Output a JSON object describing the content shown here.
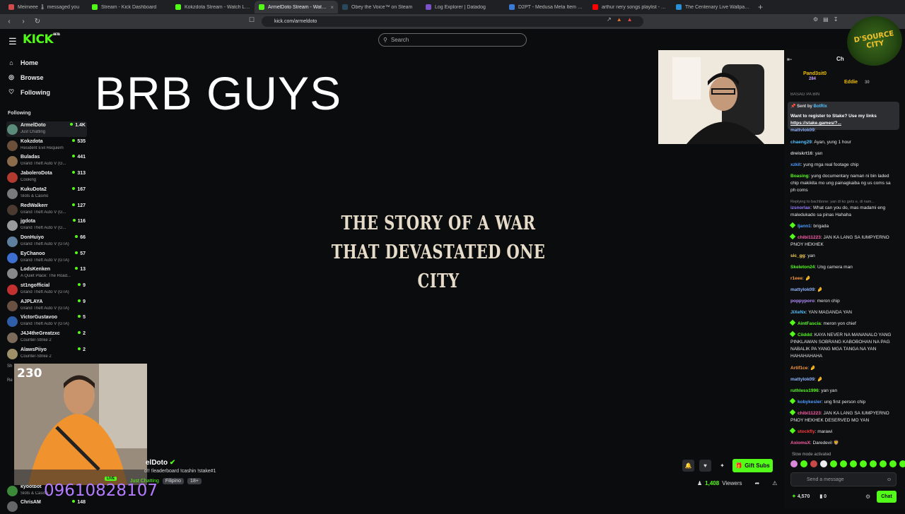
{
  "browser": {
    "tabs": [
      {
        "label": "Meimeee 🌡 messaged you",
        "color": "#d24b4b"
      },
      {
        "label": "Stream - Kick Dashboard",
        "color": "#53fc18"
      },
      {
        "label": "Kokzdota Stream - Watch Live on Ki",
        "color": "#53fc18"
      },
      {
        "label": "ArmelDoto Stream - Watch L",
        "color": "#53fc18",
        "active": true
      },
      {
        "label": "Obey the Voice™ on Steam",
        "color": "#2a475e"
      },
      {
        "label": "Log Explorer | Datadog",
        "color": "#7b52c9"
      },
      {
        "label": "D2PT - Medusa Meta Item Builds & ",
        "color": "#3a7bd5"
      },
      {
        "label": "arthur nery songs playlist - YouTube",
        "color": "#ff0000"
      },
      {
        "label": "The Centenary Live Wallpaper",
        "color": "#2b8fd6"
      }
    ],
    "new_tab": "+",
    "url": "kick.com/armeldoto"
  },
  "header": {
    "logo": "KICK",
    "logo_beta": "BETA",
    "search_placeholder": "Search"
  },
  "nav": {
    "home": "Home",
    "browse": "Browse",
    "following": "Following"
  },
  "following": {
    "heading": "Following",
    "channels": [
      {
        "name": "ArmelDoto",
        "game": "Just Chatting",
        "viewers": "1.4K",
        "color": "#5b8c7a"
      },
      {
        "name": "Kokzdota",
        "game": "Resident Evil Requiem",
        "viewers": "535",
        "color": "#6b4f3a"
      },
      {
        "name": "Buladas",
        "game": "Grand Theft Auto V (G...",
        "viewers": "441",
        "color": "#8a6c4a"
      },
      {
        "name": "JaboleroDota",
        "game": "Cooking",
        "viewers": "313",
        "color": "#b23a2e"
      },
      {
        "name": "KukuDota2",
        "game": "Slots & Casino",
        "viewers": "167",
        "color": "#7a7a7a"
      },
      {
        "name": "RedWalkerr",
        "game": "Grand Theft Auto V (G...",
        "viewers": "127",
        "color": "#4a3a30"
      },
      {
        "name": "jgdota",
        "game": "Grand Theft Auto V (G...",
        "viewers": "116",
        "color": "#9a9a9a"
      },
      {
        "name": "DonHuiyo",
        "game": "Grand Theft Auto V (GTA)",
        "viewers": "66",
        "color": "#5f7fa0"
      },
      {
        "name": "EyChanoo",
        "game": "Grand Theft Auto V (GTA)",
        "viewers": "57",
        "color": "#3c6fd0"
      },
      {
        "name": "LodsKenken",
        "game": "A Quiet Place: The Road...",
        "viewers": "13",
        "color": "#888888"
      },
      {
        "name": "st1ngofficial",
        "game": "Grand Theft Auto V (GTA)",
        "viewers": "9",
        "color": "#c23030"
      },
      {
        "name": "AJPLAYA",
        "game": "Grand Theft Auto V (GTA)",
        "viewers": "9",
        "color": "#6a5040"
      },
      {
        "name": "VictorGustavoo",
        "game": "Grand Theft Auto V (GTA)",
        "viewers": "5",
        "color": "#2e5ea8"
      },
      {
        "name": "J4J4theGreatzxc",
        "game": "Counter-Strike 2",
        "viewers": "2",
        "color": "#7c6a5a"
      },
      {
        "name": "AlawsPiiyo",
        "game": "Counter-Strike 2",
        "viewers": "2",
        "color": "#a0906a"
      }
    ],
    "partial": [
      {
        "name": "kyootbot",
        "game": "Slots & Casino",
        "viewers": "",
        "color": "#3a8a3a"
      },
      {
        "name": "ChrisAM",
        "game": "",
        "viewers": "148",
        "color": "#666666"
      }
    ],
    "clipped_text_1": "Sh",
    "clipped_text_2": "Re",
    "clipped_text_3": "Slots & Casino"
  },
  "stream": {
    "brb_text": "BRB GUYS",
    "story_line1": "THE STORY OF A WAR",
    "story_line2": "THAT DEVASTATED ONE CITY",
    "cam_count": "230",
    "phone": "09610828107",
    "live_badge": "LIVE",
    "streamer_name": "elDoto",
    "streamer_title": "o!! !leaderboard !cashin !stake#1",
    "category": "Just Chatting",
    "tags": [
      "Filipino",
      "18+"
    ],
    "viewers_count": "1,408",
    "viewers_label": "Viewers",
    "gift_subs": "Gift Subs"
  },
  "chat": {
    "header": "Ch",
    "leaderboard": [
      {
        "name": "Pand3sit0",
        "value": "284"
      },
      {
        "name": "Eddie",
        "value": "30"
      }
    ],
    "clipped_top_line": "BASAG PA BIN",
    "pinned": {
      "sender_prefix": "Sent by",
      "sender": "BotRix",
      "text": "Want to register to Stake? Use my links",
      "link": "https://stake.games/?..."
    },
    "messages": [
      {
        "user": "mattylok09",
        "text": "",
        "color": "#8fb4ff",
        "badge": false,
        "clipped": true
      },
      {
        "user": "chaeng29",
        "text": "Ayan, yung 1 hour",
        "color": "#53c1ff",
        "badge": false
      },
      {
        "user": "dreiskrt16",
        "text": "yan",
        "color": "#cccccc",
        "badge": false
      },
      {
        "user": "xzkit",
        "text": "yung mga real footage chip",
        "color": "#4d9dff",
        "badge": false
      },
      {
        "user": "Boasing",
        "text": "yung documentary naman ni bin laded chip makikita mo ung painagkaiba ng us coms sa ph coms",
        "color": "#53fc18",
        "badge": false
      },
      {
        "reply": "Replying to bachbone: yan di ko gets e, di nam..."
      },
      {
        "user": "izsnorlax",
        "text": "What can you do, mas madami eng maledukado sa pinas Hahaha",
        "color": "#9b7dff",
        "badge": false
      },
      {
        "user": "ljann1",
        "text": "brigada",
        "color": "#4d9dff",
        "badge": true
      },
      {
        "user": "chibi11223",
        "text": "JAN KA LANG SA IUMPYERNO PNOY HEKHEK",
        "color": "#ff5ea8",
        "badge": true
      },
      {
        "user": "sic_gg",
        "text": "yan",
        "color": "#ffd84d",
        "badge": false
      },
      {
        "user": "Skeleton24",
        "text": "Ung camera man",
        "color": "#53fc18",
        "badge": false
      },
      {
        "user": "r1eee",
        "text": "🤌",
        "color": "#ff9a3c",
        "badge": false
      },
      {
        "user": "mattylok09",
        "text": "🤌",
        "color": "#8fb4ff",
        "badge": false
      },
      {
        "user": "poppyporo",
        "text": "meron chip",
        "color": "#b48cff",
        "badge": false
      },
      {
        "user": "JiXeNx",
        "text": "YAN MAGANDA YAN",
        "color": "#53c1ff",
        "badge": false
      },
      {
        "user": "AintFascia",
        "text": "meron yon chief",
        "color": "#53fc18",
        "badge": true
      },
      {
        "user": "Ciiddd",
        "text": "KAYA NEVER NA MANANALO YANG PINKLAWAN SOBRANG KABOBOHAN NA PAG NABALIK PA YANG MGA TANGA NA YAN HAHAHAHAHA",
        "color": "#53fc18",
        "badge": true
      },
      {
        "user": "Artif1ce",
        "text": "🤌",
        "color": "#ff9a3c",
        "badge": false
      },
      {
        "user": "mattylok09",
        "text": "🤌",
        "color": "#8fb4ff",
        "badge": false
      },
      {
        "user": "ruthless1996",
        "text": "yan yan",
        "color": "#53fc18",
        "badge": false
      },
      {
        "user": "kobykesler",
        "text": "ung first person chip",
        "color": "#4d9dff",
        "badge": true
      },
      {
        "user": "chibi11223",
        "text": "JAN KA LANG SA IUMPYERNO PNOY HEKHEK DESERVED MO YAN",
        "color": "#ff5ea8",
        "badge": true
      },
      {
        "user": "stockfly",
        "text": "marawi",
        "color": "#ff3c3c",
        "badge": true
      },
      {
        "user": "AxiomsX",
        "text": "Daredevil 🦁",
        "color": "#ff5ea8",
        "badge": false
      }
    ],
    "slow_mode": "Slow mode activated",
    "message_placeholder": "Send a message",
    "points": "4,570",
    "points2": "0",
    "chat_button": "Chat"
  },
  "overlay": {
    "dsource_line1": "D'SOURCE",
    "dsource_line2": "CITY"
  }
}
